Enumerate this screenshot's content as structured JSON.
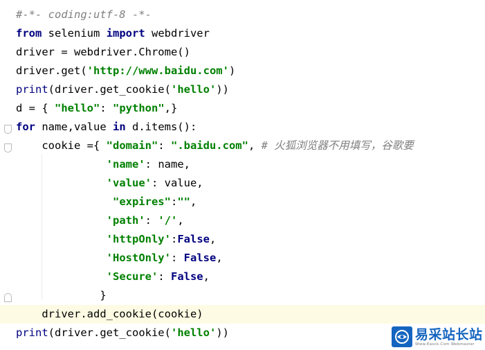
{
  "editor": {
    "lines": [
      {
        "tokens": [
          {
            "t": "#-*- coding:utf-8 -*-",
            "c": "cmt"
          }
        ]
      },
      {
        "tokens": [
          {
            "t": "from",
            "c": "kw"
          },
          {
            "t": " selenium "
          },
          {
            "t": "import",
            "c": "kw"
          },
          {
            "t": " webdriver"
          }
        ]
      },
      {
        "tokens": [
          {
            "t": "driver = webdriver.Chrome()"
          }
        ]
      },
      {
        "tokens": [
          {
            "t": "driver.get("
          },
          {
            "t": "'http://www.baidu.com'",
            "c": "str"
          },
          {
            "t": ")"
          }
        ]
      },
      {
        "tokens": [
          {
            "t": "print",
            "c": "bi"
          },
          {
            "t": "(driver.get_cookie("
          },
          {
            "t": "'hello'",
            "c": "str"
          },
          {
            "t": "))"
          }
        ]
      },
      {
        "tokens": [
          {
            "t": "d = { "
          },
          {
            "t": "\"hello\"",
            "c": "str"
          },
          {
            "t": ": "
          },
          {
            "t": "\"python\"",
            "c": "str"
          },
          {
            "t": ",}"
          }
        ]
      },
      {
        "tokens": [
          {
            "t": "for",
            "c": "kw"
          },
          {
            "t": " name,value "
          },
          {
            "t": "in",
            "c": "kw"
          },
          {
            "t": " d.items():"
          }
        ]
      },
      {
        "tokens": [
          {
            "t": "    cookie ={ "
          },
          {
            "t": "\"domain\"",
            "c": "str"
          },
          {
            "t": ": "
          },
          {
            "t": "\".baidu.com\"",
            "c": "str"
          },
          {
            "t": ", "
          },
          {
            "t": "# 火狐浏览器不用填写，谷歌要",
            "c": "cmt"
          }
        ]
      },
      {
        "tokens": [
          {
            "t": "              "
          },
          {
            "t": "'name'",
            "c": "str"
          },
          {
            "t": ": name,"
          }
        ]
      },
      {
        "tokens": [
          {
            "t": "              "
          },
          {
            "t": "'value'",
            "c": "str"
          },
          {
            "t": ": value,"
          }
        ]
      },
      {
        "tokens": [
          {
            "t": "               "
          },
          {
            "t": "\"expires\"",
            "c": "str"
          },
          {
            "t": ":"
          },
          {
            "t": "\"\"",
            "c": "str"
          },
          {
            "t": ","
          }
        ]
      },
      {
        "tokens": [
          {
            "t": "              "
          },
          {
            "t": "'path'",
            "c": "str"
          },
          {
            "t": ": "
          },
          {
            "t": "'/'",
            "c": "str"
          },
          {
            "t": ","
          }
        ]
      },
      {
        "tokens": [
          {
            "t": "              "
          },
          {
            "t": "'httpOnly'",
            "c": "str"
          },
          {
            "t": ":"
          },
          {
            "t": "False",
            "c": "kw"
          },
          {
            "t": ","
          }
        ]
      },
      {
        "tokens": [
          {
            "t": "              "
          },
          {
            "t": "'HostOnly'",
            "c": "str"
          },
          {
            "t": ": "
          },
          {
            "t": "False",
            "c": "kw"
          },
          {
            "t": ","
          }
        ]
      },
      {
        "tokens": [
          {
            "t": "              "
          },
          {
            "t": "'Secure'",
            "c": "str"
          },
          {
            "t": ": "
          },
          {
            "t": "False",
            "c": "kw"
          },
          {
            "t": ","
          }
        ]
      },
      {
        "tokens": [
          {
            "t": "             }"
          }
        ]
      },
      {
        "tokens": [
          {
            "t": "    driver.add_cookie(cookie)"
          }
        ],
        "current": true
      },
      {
        "tokens": [
          {
            "t": "print",
            "c": "bi"
          },
          {
            "t": "(driver.get_cookie("
          },
          {
            "t": "'hello'",
            "c": "str"
          },
          {
            "t": "))"
          }
        ]
      }
    ]
  },
  "watermark": {
    "title": "易采站长站",
    "url": "Www.Easck.Com  Webmaster",
    "logo_icon": "globe-icon"
  },
  "colors": {
    "keyword": "#000080",
    "string": "#008000",
    "comment": "#808080",
    "current_line": "#fdfbe3",
    "watermark_blue": "#1565c0"
  }
}
